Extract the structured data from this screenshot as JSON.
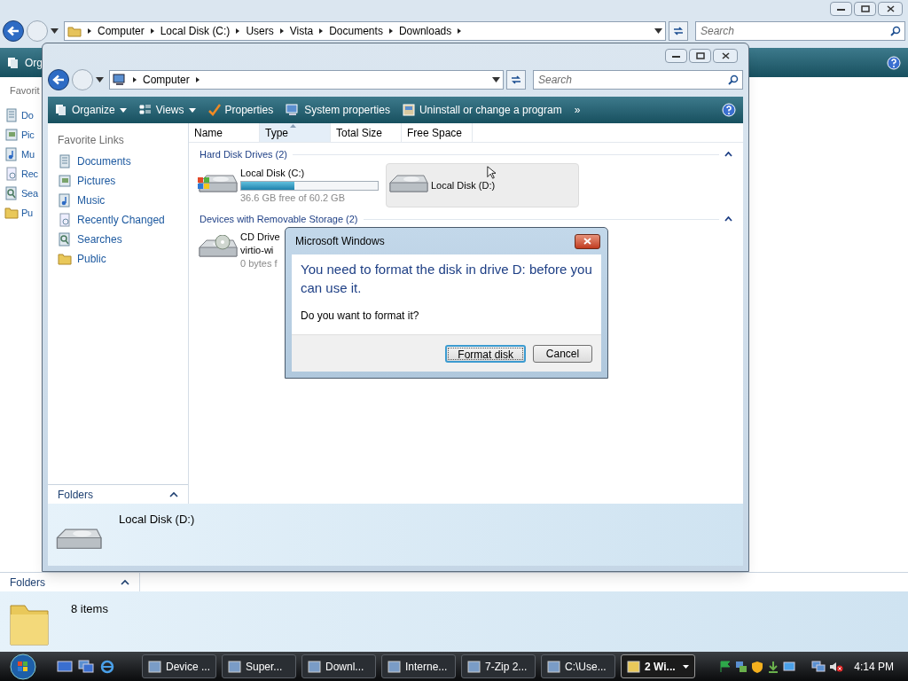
{
  "back_window": {
    "address": [
      "Computer",
      "Local Disk (C:)",
      "Users",
      "Vista",
      "Documents",
      "Downloads"
    ],
    "search": {
      "placeholder": "Search"
    },
    "toolbar": [
      "Org"
    ],
    "favorites_heading": "Favorit",
    "favorite_links": [
      "Do",
      "Pic",
      "Mu",
      "Rec",
      "Sea",
      "Pu"
    ],
    "folders_label": "Folders",
    "details": "8 items"
  },
  "front_window": {
    "address": [
      "Computer"
    ],
    "search": {
      "placeholder": "Search"
    },
    "toolbar": [
      {
        "label": "Organize",
        "menu": true
      },
      {
        "label": "Views",
        "menu": true
      },
      {
        "label": "Properties",
        "menu": false
      },
      {
        "label": "System properties",
        "menu": false
      },
      {
        "label": "Uninstall or change a program",
        "menu": false
      },
      {
        "label": "»",
        "menu": false
      }
    ],
    "favorites_heading": "Favorite Links",
    "favorite_links": [
      "Documents",
      "Pictures",
      "Music",
      "Recently Changed",
      "Searches",
      "Public"
    ],
    "folders_label": "Folders",
    "columns": [
      {
        "label": "Name",
        "sorted": false
      },
      {
        "label": "Type",
        "sorted": true
      },
      {
        "label": "Total Size",
        "sorted": false
      },
      {
        "label": "Free Space",
        "sorted": false
      }
    ],
    "groups": [
      {
        "title": "Hard Disk Drives (2)",
        "expanded": true,
        "items": [
          {
            "kind": "system",
            "name": "Local Disk (C:)",
            "level": 0.39,
            "reading": "36.6 GB free of 60.2 GB",
            "selected": false
          },
          {
            "kind": "drive",
            "name": "Local Disk (D:)",
            "selected": true
          }
        ]
      },
      {
        "title": "Devices with Removable Storage (2)",
        "expanded": true,
        "items": [
          {
            "kind": "cd",
            "name": "CD Drive",
            "label": "virtio-wi",
            "reading": "0 bytes f",
            "selected": false
          }
        ]
      }
    ],
    "details": "Local Disk (D:)"
  },
  "dialog": {
    "title": "Microsoft Windows",
    "instruction": "You need to format the disk in drive D: before you can use it.",
    "text": "Do you want to format it?",
    "buttons": [
      {
        "label": "Format disk",
        "default": true
      },
      {
        "label": "Cancel",
        "default": false
      }
    ]
  },
  "taskbar": {
    "buttons": [
      {
        "label": "Device ...",
        "selected": false
      },
      {
        "label": "Super...",
        "selected": false
      },
      {
        "label": "Downl...",
        "selected": false
      },
      {
        "label": "Interne...",
        "selected": false
      },
      {
        "label": "7-Zip 2...",
        "selected": false
      },
      {
        "label": "C:\\Use...",
        "selected": false
      },
      {
        "label": "2 Wi...",
        "selected": true
      }
    ],
    "clock": "4:14 PM"
  }
}
